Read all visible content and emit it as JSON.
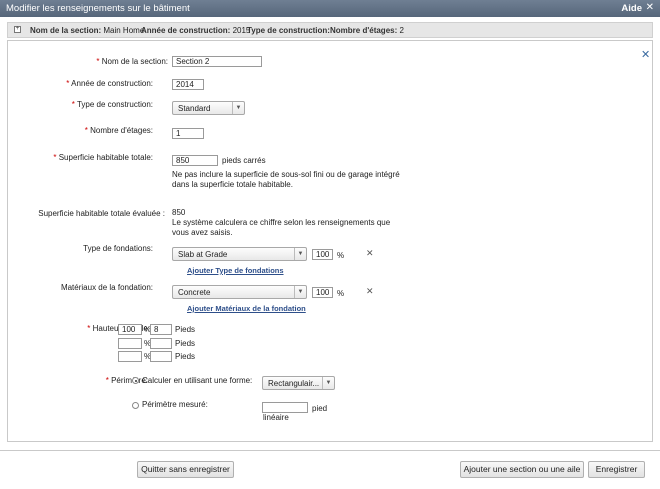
{
  "window": {
    "title": "Modifier les renseignements sur le bâtiment",
    "help": "Aide",
    "close": "✕"
  },
  "info": {
    "section_label": "Nom de la section:",
    "section_value": "Main Home",
    "year_label": "Année de construction:",
    "year_value": "2015",
    "type_label": "Type de construction:",
    "floors_label": "Nombre d'étages:",
    "floors_value": "2"
  },
  "form": {
    "required_mark": "*",
    "section_name": {
      "label": "Nom de la section:",
      "value": "Section 2"
    },
    "year": {
      "label": "Année de construction:",
      "value": "2014"
    },
    "construction_type": {
      "label": "Type de construction:",
      "value": "Standard"
    },
    "floors": {
      "label": "Nombre d'étages:",
      "value": "1"
    },
    "living_area": {
      "label": "Superficie habitable totale:",
      "value": "850",
      "unit": "pieds carrés",
      "note1": "Ne pas inclure la superficie de sous-sol fini ou de garage intégré",
      "note2": "dans la superficie totale habitable."
    },
    "estimated": {
      "label": "Superficie habitable totale évaluée :",
      "value": "850",
      "note1": "Le système calculera ce chiffre selon les renseignements que",
      "note2": "vous avez saisis."
    },
    "foundation_type": {
      "label": "Type de fondations:",
      "value": "Slab at Grade",
      "percent": "100",
      "pct_sign": "%",
      "add_link": "Ajouter Type de fondations",
      "remove": "✕"
    },
    "foundation_material": {
      "label": "Matériaux de la fondation:",
      "value": "Concrete",
      "percent": "100",
      "pct_sign": "%",
      "add_link": "Ajouter Matériaux de la fondation",
      "remove": "✕"
    },
    "wall_height": {
      "label": "Hauteur murale:",
      "pct_sign": "%",
      "unit": "Pieds",
      "rows": [
        {
          "pct": "100",
          "feet": "8"
        },
        {
          "pct": "",
          "feet": ""
        },
        {
          "pct": "",
          "feet": ""
        }
      ]
    },
    "perimeter": {
      "label": "Périmètre:",
      "option1": "Calculer en utilisant une forme:",
      "shape": "Rectangulair...",
      "option2": "Périmètre mesuré:",
      "measured_value": "",
      "unit1": "pied",
      "unit2": "linéaire"
    }
  },
  "buttons": {
    "quit": "Quitter sans enregistrer",
    "add_section": "Ajouter une section ou une aile",
    "save": "Enregistrer"
  },
  "icons": {
    "dropdown": "▼",
    "expand": "+"
  }
}
